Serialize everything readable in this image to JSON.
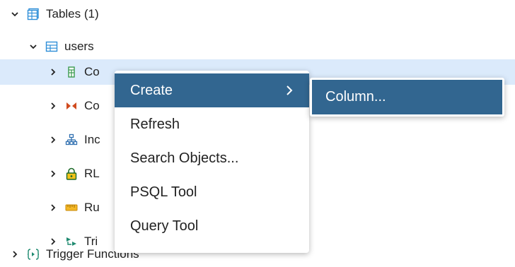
{
  "tree": {
    "tables": {
      "label": "Tables (1)"
    },
    "users": {
      "label": "users"
    },
    "children": [
      {
        "label": "Co",
        "icon": "columns-icon"
      },
      {
        "label": "Co",
        "icon": "constraints-icon"
      },
      {
        "label": "Inc",
        "icon": "indexes-icon"
      },
      {
        "label": "RL",
        "icon": "rls-policies-icon"
      },
      {
        "label": "Ru",
        "icon": "rules-icon"
      },
      {
        "label": "Tri",
        "icon": "triggers-icon"
      }
    ],
    "trigger_functions": {
      "label": "Trigger Functions"
    }
  },
  "context_menu": {
    "items": [
      {
        "label": "Create",
        "has_submenu": true,
        "active": true
      },
      {
        "label": "Refresh"
      },
      {
        "label": "Search Objects..."
      },
      {
        "label": "PSQL Tool"
      },
      {
        "label": "Query Tool"
      }
    ]
  },
  "submenu": {
    "items": [
      {
        "label": "Column..."
      }
    ]
  },
  "colors": {
    "selected_row": "#dbeafb",
    "menu_active": "#326690",
    "table_icon": "#2f8fd8"
  }
}
